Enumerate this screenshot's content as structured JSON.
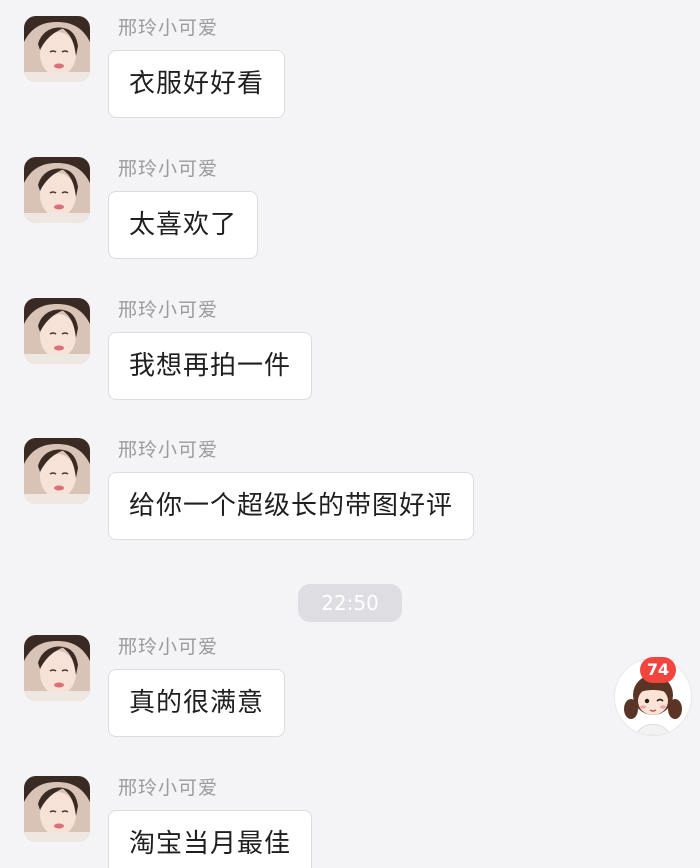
{
  "messages": [
    {
      "sender": "邢玲小可爱",
      "text": "衣服好好看"
    },
    {
      "sender": "邢玲小可爱",
      "text": "太喜欢了"
    },
    {
      "sender": "邢玲小可爱",
      "text": "我想再拍一件"
    },
    {
      "sender": "邢玲小可爱",
      "text": "给你一个超级长的带图好评"
    },
    {
      "sender": "邢玲小可爱",
      "text": "真的很满意"
    },
    {
      "sender": "邢玲小可爱",
      "text": "淘宝当月最佳"
    }
  ],
  "timestamp": "22:50",
  "floating_widget": {
    "badge_count": "74",
    "icon": "cartoon-girl-avatar-icon"
  },
  "colors": {
    "background": "#f4f4f6",
    "bubble": "#ffffff",
    "badge": "#f2453d",
    "sender_text": "#9a9a9f"
  }
}
